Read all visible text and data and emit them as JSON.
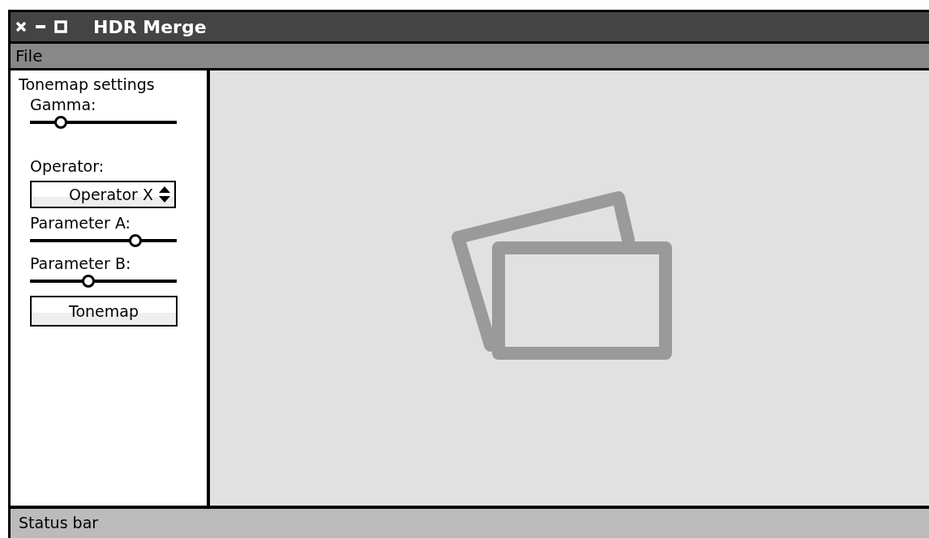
{
  "window": {
    "title": "HDR Merge"
  },
  "menu": [
    {
      "label": "File"
    }
  ],
  "sidebar": {
    "title": "Tonemap settings",
    "items": [
      {
        "kind": "slider",
        "label": "Gamma:",
        "level": 0.21
      },
      {
        "kind": "select",
        "label": "Operator:",
        "value": "Operator X"
      },
      {
        "kind": "slider",
        "label": "Parameter A:",
        "level": 0.72
      },
      {
        "kind": "slider",
        "label": "Parameter B:",
        "level": 0.4
      },
      {
        "kind": "button",
        "label": "Tonemap"
      }
    ]
  },
  "status_bar": {
    "text": "Status bar"
  }
}
